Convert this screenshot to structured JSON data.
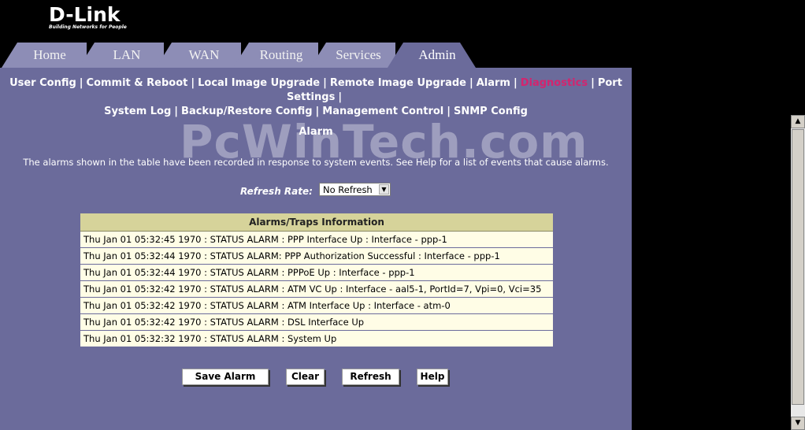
{
  "logo": {
    "brand": "D-Link",
    "tagline": "Building Networks for People"
  },
  "tabs": [
    {
      "label": "Home"
    },
    {
      "label": "LAN"
    },
    {
      "label": "WAN"
    },
    {
      "label": "Routing"
    },
    {
      "label": "Services"
    },
    {
      "label": "Admin",
      "active": true
    }
  ],
  "subnav": {
    "items": [
      "User Config",
      "Commit & Reboot",
      "Local Image Upgrade",
      "Remote Image Upgrade",
      "Alarm",
      "Diagnostics",
      "Port Settings",
      "System Log",
      "Backup/Restore Config",
      "Management Control",
      "SNMP Config"
    ],
    "separator": "|"
  },
  "page": {
    "title": "Alarm",
    "description": "The alarms shown in the table have been recorded in response to system events. See Help for a list of events that cause alarms."
  },
  "refresh": {
    "label": "Refresh Rate:",
    "selected": "No Refresh"
  },
  "watermark": "PcWinTech.com",
  "table": {
    "header": "Alarms/Traps Information",
    "rows": [
      "Thu Jan 01 05:32:45 1970 : STATUS ALARM : PPP Interface Up : Interface - ppp-1",
      "Thu Jan 01 05:32:44 1970 : STATUS ALARM: PPP Authorization Successful : Interface - ppp-1",
      "Thu Jan 01 05:32:44 1970 : STATUS ALARM : PPPoE Up : Interface - ppp-1",
      "Thu Jan 01 05:32:42 1970 : STATUS ALARM : ATM VC Up : Interface - aal5-1, PortId=7, Vpi=0, Vci=35",
      "Thu Jan 01 05:32:42 1970 : STATUS ALARM : ATM Interface Up : Interface - atm-0",
      "Thu Jan 01 05:32:42 1970 : STATUS ALARM : DSL Interface Up",
      "Thu Jan 01 05:32:32 1970 : STATUS ALARM : System Up"
    ]
  },
  "buttons": {
    "save": "Save Alarm",
    "clear": "Clear",
    "refresh": "Refresh",
    "help": "Help"
  },
  "colors": {
    "panel": "#6b6b9b",
    "tab": "#8d8db6",
    "active_link": "#d4246e",
    "table_header": "#d6d39a",
    "table_row": "#fffde6"
  }
}
